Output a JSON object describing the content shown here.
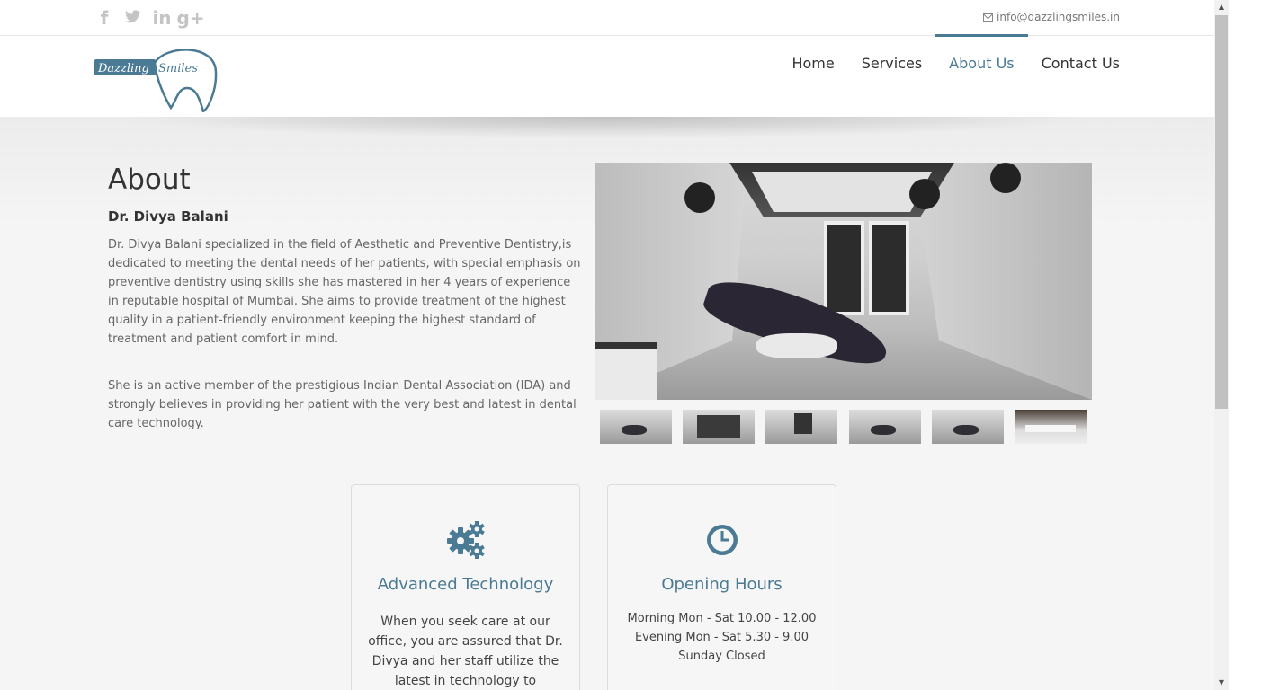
{
  "topbar": {
    "social": [
      {
        "name": "facebook-icon",
        "glyph": "f"
      },
      {
        "name": "twitter-icon",
        "glyph": "t"
      },
      {
        "name": "linkedin-icon",
        "glyph": "in"
      },
      {
        "name": "google-plus-icon",
        "glyph": "g+"
      }
    ],
    "email": "info@dazzlingsmiles.in"
  },
  "header": {
    "logo_text_1": "Dazzling",
    "logo_text_2": "Smiles",
    "nav": [
      {
        "label": "Home",
        "active": false
      },
      {
        "label": "Services",
        "active": false
      },
      {
        "label": "About Us",
        "active": true
      },
      {
        "label": "Contact Us",
        "active": false
      }
    ]
  },
  "about": {
    "title": "About",
    "name": "Dr. Divya Balani",
    "para1": "Dr. Divya Balani specialized in the field of Aesthetic and Preventive Dentistry,is dedicated to meeting the dental needs of her patients, with special emphasis on preventive dentistry using skills she has mastered in her 4 years of experience in reputable hospital of Mumbai. She aims to provide treatment of the highest quality in a patient-friendly environment keeping the highest standard of treatment and patient comfort in mind.",
    "para2": "She is an active member of the prestigious Indian Dental Association (IDA) and strongly believes in providing her patient with the very best and latest in dental care technology."
  },
  "gallery": {
    "thumbnails": 6
  },
  "cards": {
    "technology": {
      "icon": "gears-icon",
      "title": "Advanced Technology",
      "text": "When you seek care at our office, you are assured that Dr. Divya and her staff utilize the latest in technology to enhance the"
    },
    "hours": {
      "icon": "clock-icon",
      "title": "Opening Hours",
      "line1": "Morning Mon - Sat 10.00 - 12.00",
      "line2": "Evening Mon - Sat 5.30 - 9.00",
      "line3": "Sunday Closed"
    }
  },
  "colors": {
    "accent": "#4a7a94",
    "text": "#666666"
  }
}
